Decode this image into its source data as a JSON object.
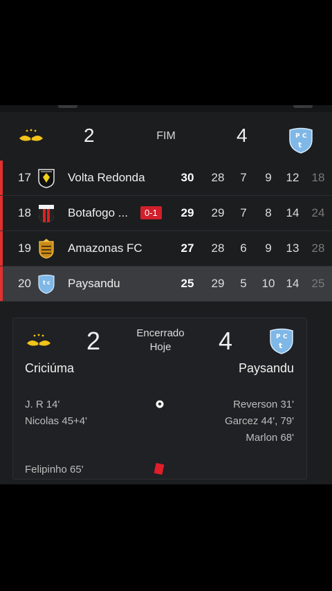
{
  "score_header": {
    "home_score": "2",
    "status": "FIM",
    "away_score": "4"
  },
  "standings": [
    {
      "pos": "17",
      "team": "Volta Redonda",
      "badge": "",
      "pts": "30",
      "p": "28",
      "w": "7",
      "d": "9",
      "l": "12",
      "extra": "18",
      "highlight": false
    },
    {
      "pos": "18",
      "team": "Botafogo ...",
      "badge": "0-1",
      "pts": "29",
      "p": "29",
      "w": "7",
      "d": "8",
      "l": "14",
      "extra": "24",
      "highlight": false
    },
    {
      "pos": "19",
      "team": "Amazonas FC",
      "badge": "",
      "pts": "27",
      "p": "28",
      "w": "6",
      "d": "9",
      "l": "13",
      "extra": "28",
      "highlight": false
    },
    {
      "pos": "20",
      "team": "Paysandu",
      "badge": "",
      "pts": "25",
      "p": "29",
      "w": "5",
      "d": "10",
      "l": "14",
      "extra": "25",
      "highlight": true
    }
  ],
  "match": {
    "home_score": "2",
    "away_score": "4",
    "status_line1": "Encerrado",
    "status_line2": "Hoje",
    "home_team": "Criciúma",
    "away_team": "Paysandu",
    "home_goals": [
      "J. R 14'",
      "Nicolas 45+4'"
    ],
    "away_goals": [
      "Reverson 31'",
      "Garcez 44', 79'",
      "Marlon 68'"
    ],
    "home_red_cards": [
      "Felipinho 65'"
    ]
  },
  "colors": {
    "relegation": "#e03030",
    "badge": "#d21f2c",
    "criciuma_yellow": "#f2c319",
    "paysandu_blue": "#7fb7e6"
  },
  "icons": {
    "home_crest": "criciuma-crest-icon",
    "away_crest": "paysandu-crest-icon",
    "goal": "soccer-ball-icon",
    "red_card": "red-card-icon"
  }
}
